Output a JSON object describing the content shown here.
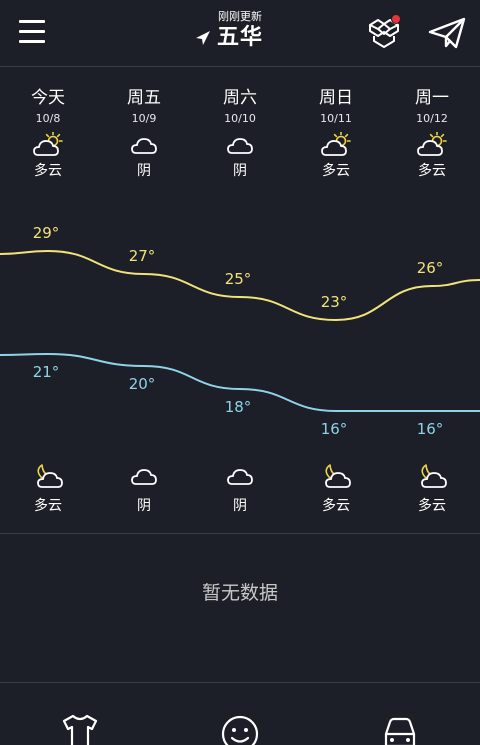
{
  "header": {
    "update_status": "刚刚更新",
    "city": "五华"
  },
  "days": [
    {
      "name": "今天",
      "date": "10/8",
      "day_condition": "多云",
      "high": "29°",
      "low": "21°",
      "night_condition": "多云"
    },
    {
      "name": "周五",
      "date": "10/9",
      "day_condition": "阴",
      "high": "27°",
      "low": "20°",
      "night_condition": "阴"
    },
    {
      "name": "周六",
      "date": "10/10",
      "day_condition": "阴",
      "high": "25°",
      "low": "18°",
      "night_condition": "阴"
    },
    {
      "name": "周日",
      "date": "10/11",
      "day_condition": "多云",
      "high": "23°",
      "low": "16°",
      "night_condition": "多云"
    },
    {
      "name": "周一",
      "date": "10/12",
      "day_condition": "多云",
      "high": "26°",
      "low": "16°",
      "night_condition": "多云"
    }
  ],
  "day_icons": [
    "partly-cloudy-day-icon",
    "cloudy-icon",
    "cloudy-icon",
    "partly-cloudy-day-icon",
    "partly-cloudy-day-icon"
  ],
  "night_icons": [
    "partly-cloudy-night-icon",
    "cloudy-icon",
    "cloudy-icon",
    "partly-cloudy-night-icon",
    "partly-cloudy-night-icon"
  ],
  "chart_data": {
    "type": "line",
    "categories": [
      "今天",
      "周五",
      "周六",
      "周日",
      "周一"
    ],
    "series": [
      {
        "values": [
          29,
          27,
          25,
          23,
          26
        ],
        "color": "#f3e27a"
      },
      {
        "values": [
          21,
          20,
          18,
          16,
          16
        ],
        "color": "#8fd3ea"
      }
    ]
  },
  "empty_state": "暂无数据",
  "colors": {
    "background": "#1c1f27",
    "high_line": "#f3e27a",
    "low_line": "#8fd3ea",
    "notification_dot": "#e8323c",
    "sun": "#f3d34a"
  },
  "bottom_tabs": [
    "shirt-icon",
    "smiley-icon",
    "car-icon"
  ]
}
